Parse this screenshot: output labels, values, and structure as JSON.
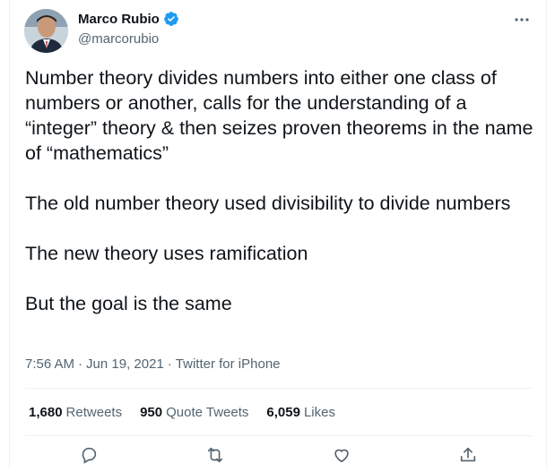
{
  "author": {
    "display_name": "Marco Rubio",
    "handle": "@marcorubio",
    "verified": true
  },
  "tweet": {
    "text": "Number theory divides numbers into either one class of numbers or another, calls for the understanding of a “integer” theory & then seizes proven theorems in the name of “mathematics”\n\nThe old number theory used divisibility to divide numbers\n\nThe new theory uses ramification\n\nBut the goal is the same",
    "time": "7:56 AM",
    "separator": "·",
    "date": "Jun 19, 2021",
    "source": "Twitter for iPhone"
  },
  "stats": [
    {
      "count": "1,680",
      "label": "Retweets"
    },
    {
      "count": "950",
      "label": "Quote Tweets"
    },
    {
      "count": "6,059",
      "label": "Likes"
    }
  ],
  "icons": {
    "verified": "verified-badge-icon",
    "more": "more-options-icon",
    "reply": "reply-icon",
    "retweet": "retweet-icon",
    "like": "like-icon",
    "share": "share-icon"
  },
  "colors": {
    "accent": "#1d9bf0",
    "text": "#0f1419",
    "secondary": "#536471",
    "divider": "#eff3f4"
  }
}
